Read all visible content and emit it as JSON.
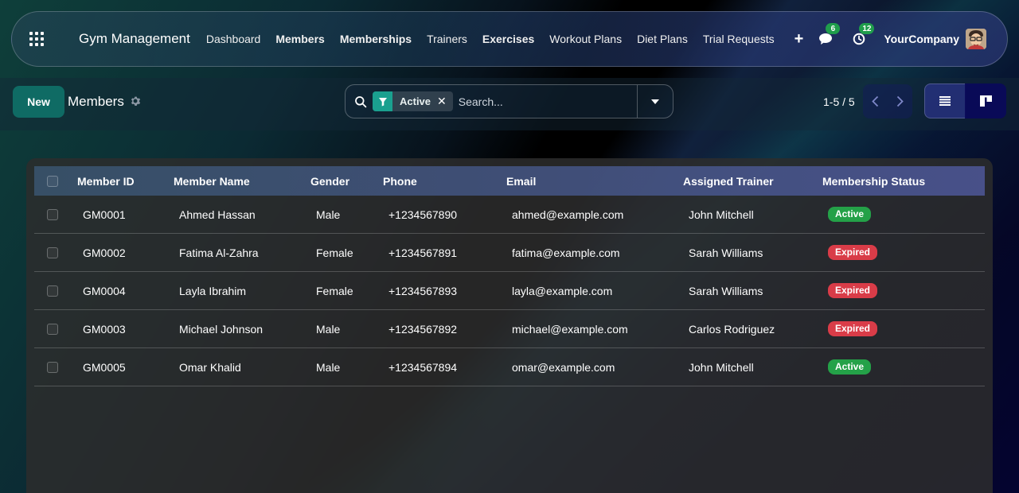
{
  "navbar": {
    "brand": "Gym Management",
    "menu": [
      {
        "label": "Dashboard",
        "bold": false
      },
      {
        "label": "Members",
        "bold": true
      },
      {
        "label": "Memberships",
        "bold": true
      },
      {
        "label": "Trainers",
        "bold": false
      },
      {
        "label": "Exercises",
        "bold": true
      },
      {
        "label": "Workout Plans",
        "bold": false
      },
      {
        "label": "Diet Plans",
        "bold": false
      },
      {
        "label": "Trial Requests",
        "bold": false
      }
    ],
    "messages_count": "6",
    "activities_count": "12",
    "company": "YourCompany"
  },
  "control_panel": {
    "new_label": "New",
    "title": "Members",
    "filter_facet": "Active",
    "search_placeholder": "Search...",
    "pager": "1-5 / 5"
  },
  "list": {
    "columns": [
      "Member ID",
      "Member Name",
      "Gender",
      "Phone",
      "Email",
      "Assigned Trainer",
      "Membership Status"
    ],
    "rows": [
      {
        "id": "GM0001",
        "name": "Ahmed Hassan",
        "gender": "Male",
        "phone": "+1234567890",
        "email": "ahmed@example.com",
        "trainer": "John Mitchell",
        "status": "Active"
      },
      {
        "id": "GM0002",
        "name": "Fatima Al-Zahra",
        "gender": "Female",
        "phone": "+1234567891",
        "email": "fatima@example.com",
        "trainer": "Sarah Williams",
        "status": "Expired"
      },
      {
        "id": "GM0004",
        "name": "Layla Ibrahim",
        "gender": "Female",
        "phone": "+1234567893",
        "email": "layla@example.com",
        "trainer": "Sarah Williams",
        "status": "Expired"
      },
      {
        "id": "GM0003",
        "name": "Michael Johnson",
        "gender": "Male",
        "phone": "+1234567892",
        "email": "michael@example.com",
        "trainer": "Carlos Rodriguez",
        "status": "Expired"
      },
      {
        "id": "GM0005",
        "name": "Omar Khalid",
        "gender": "Male",
        "phone": "+1234567894",
        "email": "omar@example.com",
        "trainer": "John Mitchell",
        "status": "Active"
      }
    ]
  },
  "colors": {
    "primary": "#0f6b64",
    "status_active": "#24a148",
    "status_expired": "#d93c48",
    "badge": "#1f9d4b"
  },
  "icons": {
    "apps": "apps-grid-icon",
    "messages": "chat-icon",
    "activities": "clock-icon",
    "settings": "gear-icon",
    "search": "search-icon",
    "filter": "filter-icon",
    "remove": "close-icon",
    "dropdown": "caret-down-icon",
    "prev": "chevron-left-icon",
    "next": "chevron-right-icon",
    "list_view": "list-view-icon",
    "kanban_view": "kanban-view-icon"
  }
}
